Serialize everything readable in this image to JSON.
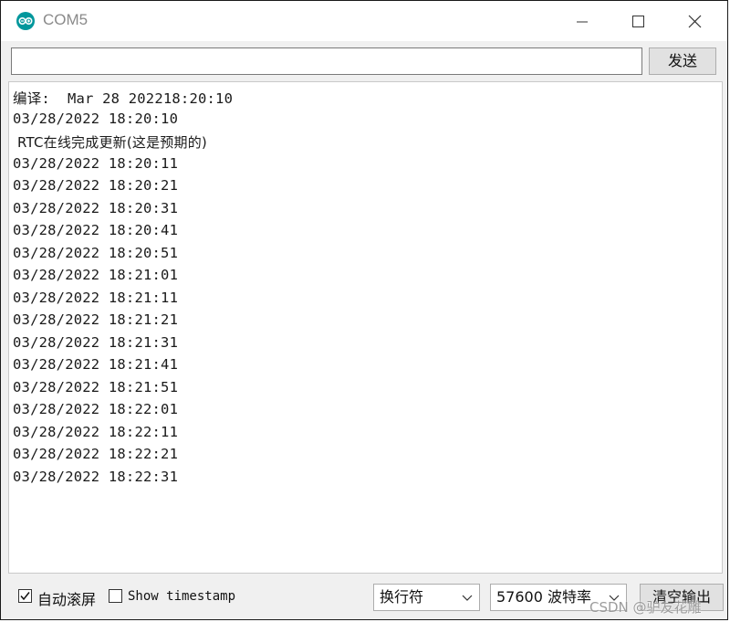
{
  "window": {
    "title": "COM5"
  },
  "send_bar": {
    "input_value": "",
    "send_label": "发送"
  },
  "output": {
    "lines": [
      "编译:  Mar 28 202218:20:10",
      "03/28/2022 18:20:10",
      " RTC在线完成更新(这是预期的)",
      "03/28/2022 18:20:11",
      "03/28/2022 18:20:21",
      "03/28/2022 18:20:31",
      "03/28/2022 18:20:41",
      "03/28/2022 18:20:51",
      "03/28/2022 18:21:01",
      "03/28/2022 18:21:11",
      "03/28/2022 18:21:21",
      "03/28/2022 18:21:31",
      "03/28/2022 18:21:41",
      "03/28/2022 18:21:51",
      "03/28/2022 18:22:01",
      "03/28/2022 18:22:11",
      "03/28/2022 18:22:21",
      "03/28/2022 18:22:31"
    ]
  },
  "bottom_bar": {
    "autoscroll_label": "自动滚屏",
    "autoscroll_checked": true,
    "timestamp_label": "Show timestamp",
    "timestamp_checked": false,
    "line_ending_value": "换行符",
    "baud_value": "57600 波特率",
    "clear_label": "清空输出"
  },
  "watermark": "CSDN @驴友花雕",
  "colors": {
    "accent": "#00979c"
  }
}
